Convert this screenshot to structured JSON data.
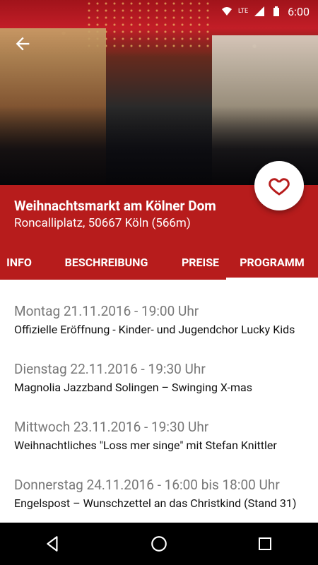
{
  "status_bar": {
    "time": "6:00",
    "network_label": "LTE"
  },
  "header": {
    "title": "Weihnachtsmarkt am Kölner Dom",
    "subtitle": "Roncalliplatz, 50667 Köln (566m)"
  },
  "tabs": [
    {
      "label": "INFO"
    },
    {
      "label": "BESCHREIBUNG"
    },
    {
      "label": "PREISE"
    },
    {
      "label": "PROGRAMM",
      "active": true
    }
  ],
  "events": [
    {
      "date": "Montag 21.11.2016 - 19:00 Uhr",
      "description": "Offizielle Eröffnung - Kinder- und Jugendchor Lucky Kids"
    },
    {
      "date": "Dienstag 22.11.2016 - 19:30 Uhr",
      "description": "Magnolia Jazzband Solingen – Swinging X-mas"
    },
    {
      "date": "Mittwoch 23.11.2016 - 19:30 Uhr",
      "description": "Weihnachtliches \"Loss mer singe\" mit Stefan Knittler"
    },
    {
      "date": "Donnerstag 24.11.2016 - 16:00 bis 18:00 Uhr",
      "description": "Engelspost – Wunschzettel an das Christkind (Stand 31)"
    }
  ],
  "colors": {
    "accent": "#b71c1c",
    "tab_indicator": "#ffffff",
    "date_text": "#777777"
  },
  "icons": {
    "back": "arrow-left-icon",
    "favorite": "heart-icon",
    "nav_back": "triangle-back-icon",
    "nav_home": "circle-home-icon",
    "nav_recents": "square-recents-icon"
  }
}
